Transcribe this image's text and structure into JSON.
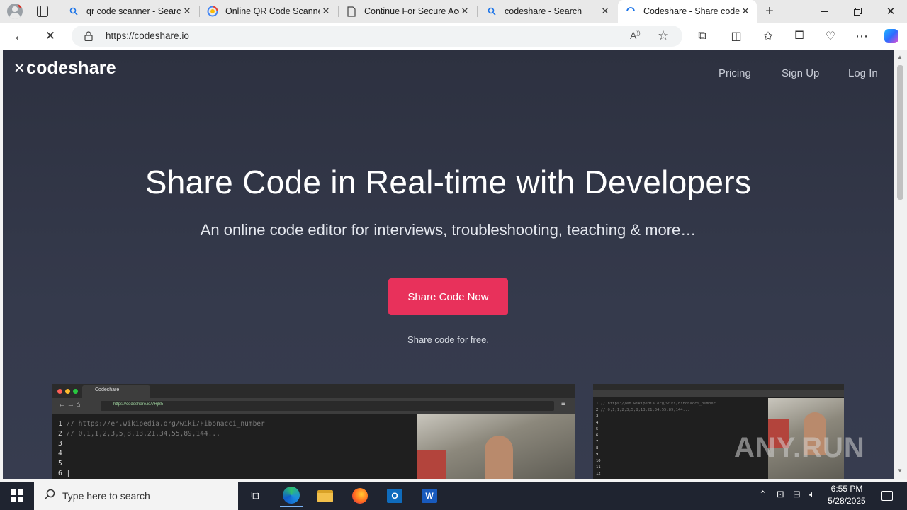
{
  "browser": {
    "tabs": [
      {
        "label": "qr code scanner - Search",
        "icon": "search-icon"
      },
      {
        "label": "Online QR Code Scanner",
        "icon": "qr-scanner-favicon"
      },
      {
        "label": "Continue For Secure Acc",
        "icon": "document-icon"
      },
      {
        "label": "codeshare - Search",
        "icon": "search-icon"
      },
      {
        "label": "Codeshare - Share code i",
        "icon": "loading-icon",
        "active": true
      }
    ],
    "url": "https://codeshare.io"
  },
  "page": {
    "logo_mark": "✕",
    "logo_text": "codeshare",
    "nav": [
      "Pricing",
      "Sign Up",
      "Log In"
    ],
    "headline": "Share Code in Real-time with Developers",
    "subhead": "An online code editor for interviews, troubleshooting, teaching & more…",
    "cta_label": "Share Code Now",
    "cta_note": "Share code for free.",
    "preview_left": {
      "tab_title": "Codeshare",
      "address": "https://codeshare.io/7HjB5",
      "lines": [
        "// https://en.wikipedia.org/wiki/Fibonacci_number",
        "// 0,1,1,2,3,5,8,13,21,34,55,89,144...",
        "",
        "",
        "",
        ""
      ]
    },
    "preview_right": {
      "lines": [
        "// https://en.wikipedia.org/wiki/Fibonacci_number",
        "// 0,1,1,2,3,5,8,13,21,34,55,89,144...",
        "",
        "",
        "",
        "",
        "",
        "",
        "",
        "",
        "",
        ""
      ]
    },
    "watermark": "ANY.RUN"
  },
  "taskbar": {
    "search_placeholder": "Type here to search",
    "time": "6:55 PM",
    "date": "5/28/2025"
  },
  "colors": {
    "page_bg": "#2d3140",
    "cta": "#e8315b",
    "taskbar": "#1f2430"
  }
}
